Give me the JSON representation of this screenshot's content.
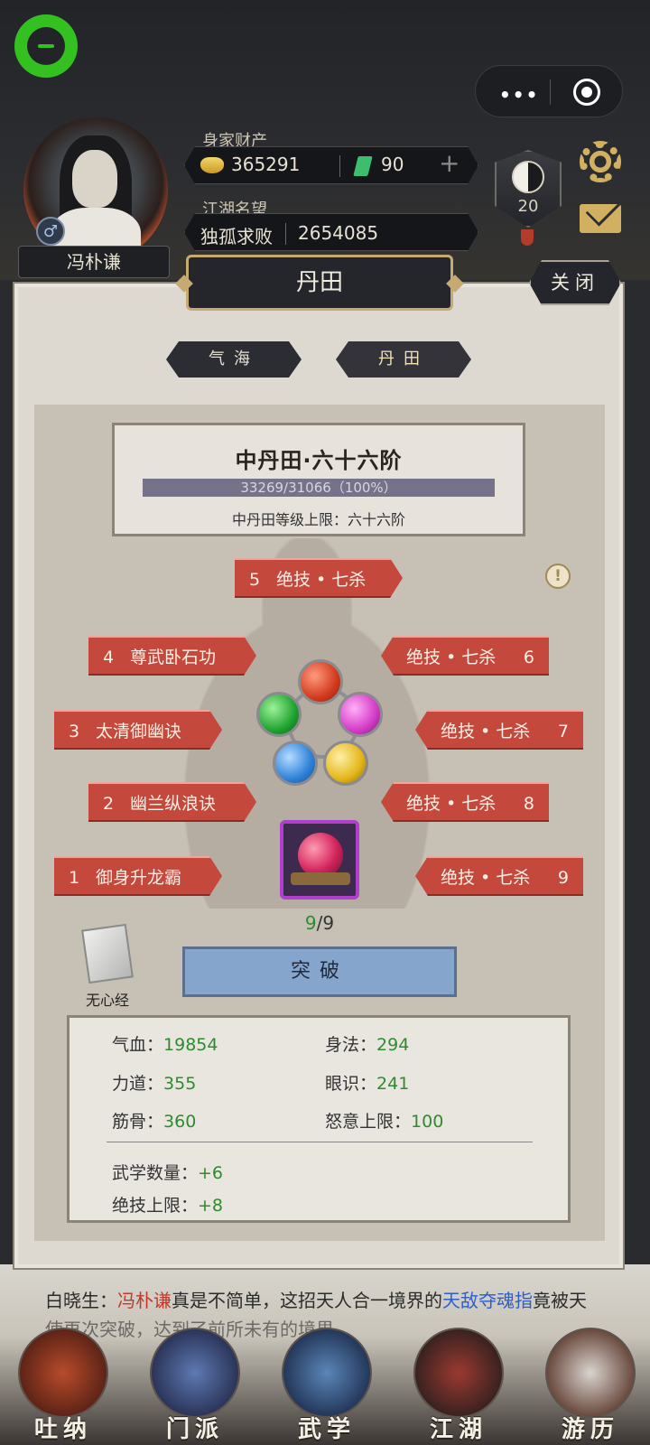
{
  "topbar": {
    "capsule_dots": "•••"
  },
  "player": {
    "name": "冯朴谦",
    "gender_symbol": "♂",
    "wealth_label": "身家财产",
    "gold": "365291",
    "jade": "90",
    "plus": "+",
    "fame_label": "江湖名望",
    "fame_title": "独孤求败",
    "fame_value": "2654085",
    "rank_level": "20"
  },
  "panel": {
    "title": "丹田",
    "close_label": "关闭",
    "tabs": [
      {
        "label": "气海",
        "active": false
      },
      {
        "label": "丹田",
        "active": true
      }
    ],
    "level_title": "中丹田·六十六阶",
    "progress_text": "33269/31066（100%）",
    "progress_fraction": 1.0,
    "level_limit": "中丹田等级上限：六十六阶",
    "warn_symbol": "!"
  },
  "skills": [
    {
      "num": "5",
      "label": "绝技 • 七杀"
    },
    {
      "num": "4",
      "label": "尊武卧石功"
    },
    {
      "num": "6",
      "label": "绝技 • 七杀"
    },
    {
      "num": "3",
      "label": "太清御幽诀"
    },
    {
      "num": "7",
      "label": "绝技 • 七杀"
    },
    {
      "num": "2",
      "label": "幽兰纵浪诀"
    },
    {
      "num": "8",
      "label": "绝技 • 七杀"
    },
    {
      "num": "1",
      "label": "御身升龙霸"
    },
    {
      "num": "9",
      "label": "绝技 • 七杀"
    }
  ],
  "slots": {
    "current": "9",
    "total": "/9"
  },
  "book_label": "无心经",
  "breakthrough_label": "突破",
  "stats": {
    "qixue_label": "气血：",
    "qixue": "19854",
    "shenfa_label": "身法：",
    "shenfa": "294",
    "lidao_label": "力道：",
    "lidao": "355",
    "yanshi_label": "眼识：",
    "yanshi": "241",
    "jingu_label": "筋骨：",
    "jingu": "360",
    "nuyi_label": "怒意上限：",
    "nuyi": "100",
    "wuxue_label": "武学数量：",
    "wuxue": "+6",
    "jueji_label": "绝技上限：",
    "jueji": "+8"
  },
  "story": {
    "speaker": "白晓生：",
    "name": "冯朴谦",
    "text1": "真是不简单，这招天人合一境界的",
    "skill": "天敌夺魂指",
    "text2": "竟被天",
    "line2": "使再次突破，达到了前所未有的境界"
  },
  "nav": [
    {
      "label": "吐纳"
    },
    {
      "label": "门派"
    },
    {
      "label": "武学"
    },
    {
      "label": "江湖"
    },
    {
      "label": "游历"
    }
  ]
}
